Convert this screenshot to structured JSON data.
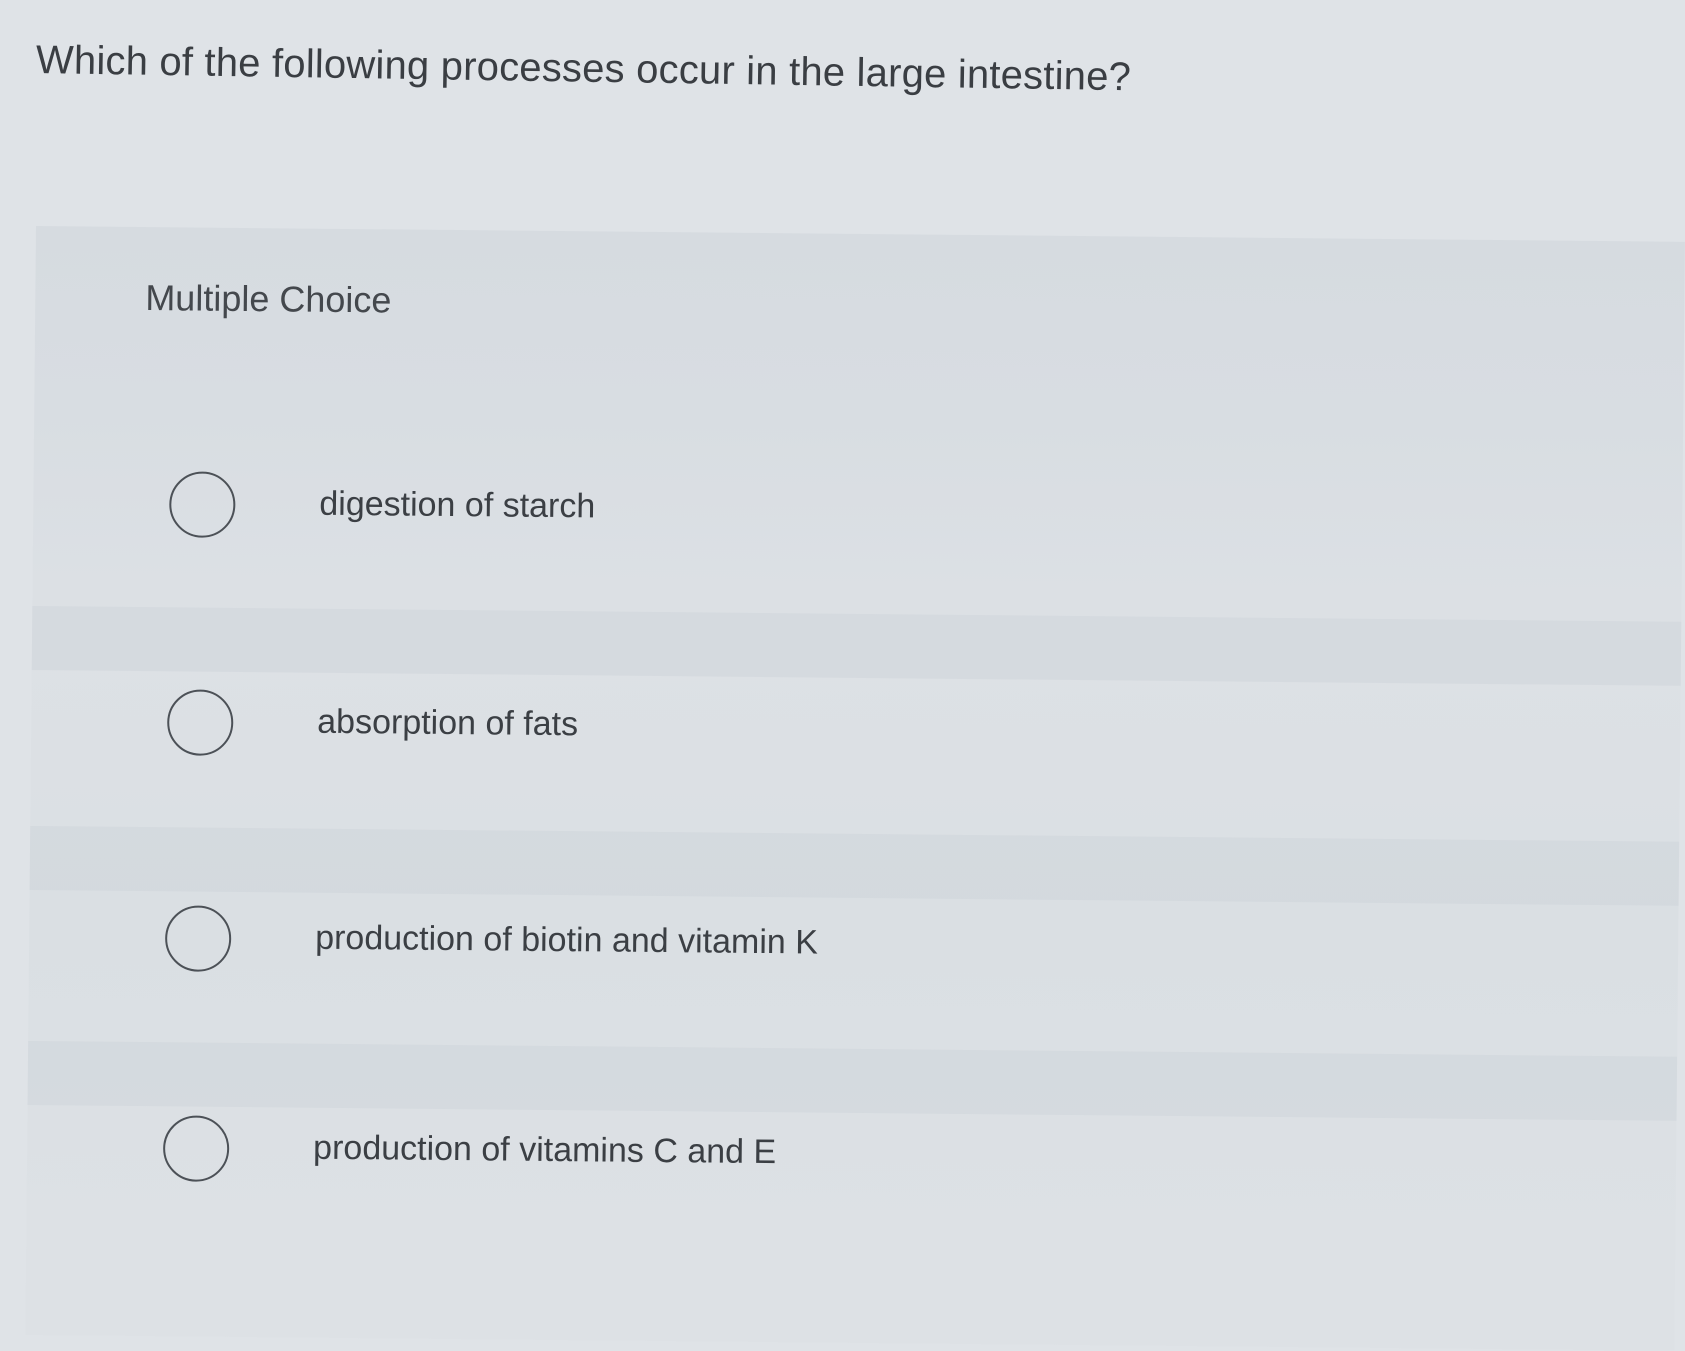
{
  "question": {
    "text": "Which of the following processes occur in the large intestine?"
  },
  "section": {
    "label": "Multiple Choice"
  },
  "choices": [
    {
      "label": "digestion of starch",
      "selected": false
    },
    {
      "label": "absorption of fats",
      "selected": false
    },
    {
      "label": "production of biotin and vitamin K",
      "selected": false
    },
    {
      "label": "production of vitamins C and E",
      "selected": false
    }
  ],
  "colors": {
    "background": "#dfe3e7",
    "panel": "#d8dde2",
    "text": "#3b3f44",
    "radio_border": "#4c5157"
  },
  "icons": {
    "radio": "radio-unselected-icon"
  }
}
